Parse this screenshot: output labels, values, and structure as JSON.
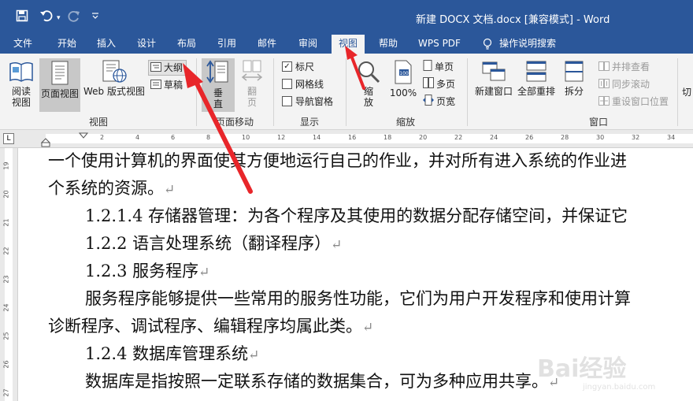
{
  "window": {
    "title": "新建 DOCX 文档.docx [兼容模式] - Word"
  },
  "quick_access": {
    "save_icon": "save-icon",
    "undo_icon": "undo-icon",
    "redo_icon": "redo-icon",
    "customize_icon": "chevron-down-icon"
  },
  "tabs": [
    {
      "label": "文件"
    },
    {
      "label": "开始"
    },
    {
      "label": "插入"
    },
    {
      "label": "设计"
    },
    {
      "label": "布局"
    },
    {
      "label": "引用"
    },
    {
      "label": "邮件"
    },
    {
      "label": "审阅"
    },
    {
      "label": "视图",
      "active": true
    },
    {
      "label": "帮助"
    },
    {
      "label": "WPS PDF"
    },
    {
      "label": "操作说明搜索"
    }
  ],
  "ribbon": {
    "views": {
      "read_mode": "阅读视图",
      "print_layout": "页面视图",
      "web_layout": "Web 版式视图",
      "outline": "大纲",
      "draft": "草稿",
      "group_label": "视图"
    },
    "page_movement": {
      "vertical": "垂直",
      "side_to_side": "翻页",
      "group_label": "页面移动"
    },
    "show": {
      "ruler": "标尺",
      "gridlines": "网格线",
      "navigation_pane": "导航窗格",
      "ruler_checked": true,
      "gridlines_checked": false,
      "navigation_checked": false,
      "group_label": "显示"
    },
    "zoom": {
      "zoom": "缩放",
      "percent_100": "100%",
      "one_page": "单页",
      "multiple_pages": "多页",
      "page_width": "页宽",
      "group_label": "缩放"
    },
    "window": {
      "new_window": "新建窗口",
      "arrange_all": "全部重排",
      "split": "拆分",
      "side_by_side": "并排查看",
      "sync_scroll": "同步滚动",
      "reset_position": "重设窗口位置",
      "switch_cut": "切",
      "group_label": "窗口"
    }
  },
  "ruler": {
    "ticks": [
      "2",
      "4",
      "6",
      "8",
      "10",
      "12",
      "14",
      "16",
      "18",
      "20",
      "22",
      "24",
      "26",
      "28",
      "30",
      "32",
      "34"
    ],
    "vticks": [
      "19",
      "20",
      "21",
      "22",
      "23",
      "24",
      "25",
      "26",
      "27"
    ]
  },
  "document": {
    "lines": [
      "一个使用计算机的界面使其方便地运行自己的作业，并对所有进入系统的作业进",
      "个系统的资源。",
      "1.2.1.4 存储器管理：为各个程序及其使用的数据分配存储空间，并保证它",
      "1.2.2 语言处理系统（翻译程序）",
      "1.2.3 服务程序",
      "服务程序能够提供一些常用的服务性功能，它们为用户开发程序和使用计算",
      "诊断程序、调试程序、编辑程序均属此类。",
      "1.2.4 数据库管理系统",
      "数据库是指按照一定联系存储的数据集合，可为多种应用共享。"
    ],
    "paragraph_mark": "↵"
  },
  "watermark": {
    "text": "Bai经验",
    "sub": "jingyan.baidu.com"
  },
  "colors": {
    "titlebar": "#2b579a",
    "arrow": "#e8262a"
  }
}
